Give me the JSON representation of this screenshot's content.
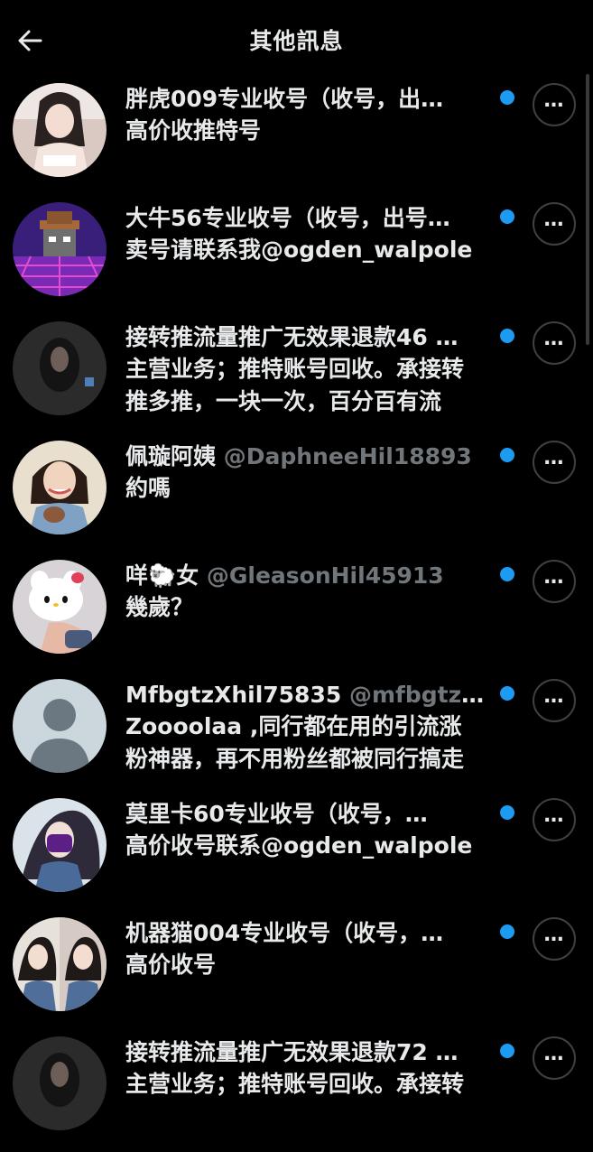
{
  "header": {
    "title": "其他訊息",
    "back_icon": "arrow-left-icon"
  },
  "colors": {
    "background": "#000000",
    "text": "#e7e9ea",
    "secondary": "#71767b",
    "unread_dot": "#1d9bf0"
  },
  "messages": [
    {
      "name": "胖虎009专业收号（收号，出…",
      "handle": "",
      "preview": "高价收推特号",
      "unread": true,
      "more_label": "…"
    },
    {
      "name": "大牛56专业收号（收号，出号…",
      "handle": "",
      "preview": "卖号请联系我@ogden_walpole",
      "unread": true,
      "more_label": "…"
    },
    {
      "name": "接转推流量推广无效果退款46 …",
      "handle": "",
      "preview": "主营业务；推特账号回收。承接转\n推多推，一块一次，百分百有流",
      "unread": true,
      "more_label": "…"
    },
    {
      "name": "佩璇阿姨",
      "handle": "@DaphneeHil18893",
      "preview": "約嗎",
      "unread": true,
      "more_label": "…"
    },
    {
      "name": "咩🐑女",
      "handle": "@GleasonHil45913",
      "preview": "幾歲？",
      "unread": true,
      "more_label": "…"
    },
    {
      "name": "MfbgtzXhil75835",
      "handle": "@mfbgtz5…",
      "preview": "Zoooolaa ,同行都在用的引流涨\n粉神器，再不用粉丝都被同行搞走",
      "unread": true,
      "more_label": "…"
    },
    {
      "name": "莫里卡60专业收号（收号，…",
      "handle": "",
      "preview": "高价收号联系@ogden_walpole",
      "unread": true,
      "more_label": "…"
    },
    {
      "name": "机器猫004专业收号（收号，…",
      "handle": "",
      "preview": "高价收号",
      "unread": true,
      "more_label": "…"
    },
    {
      "name": "接转推流量推广无效果退款72 …",
      "handle": "",
      "preview": "主营业务；推特账号回收。承接转",
      "unread": true,
      "more_label": "…"
    }
  ]
}
